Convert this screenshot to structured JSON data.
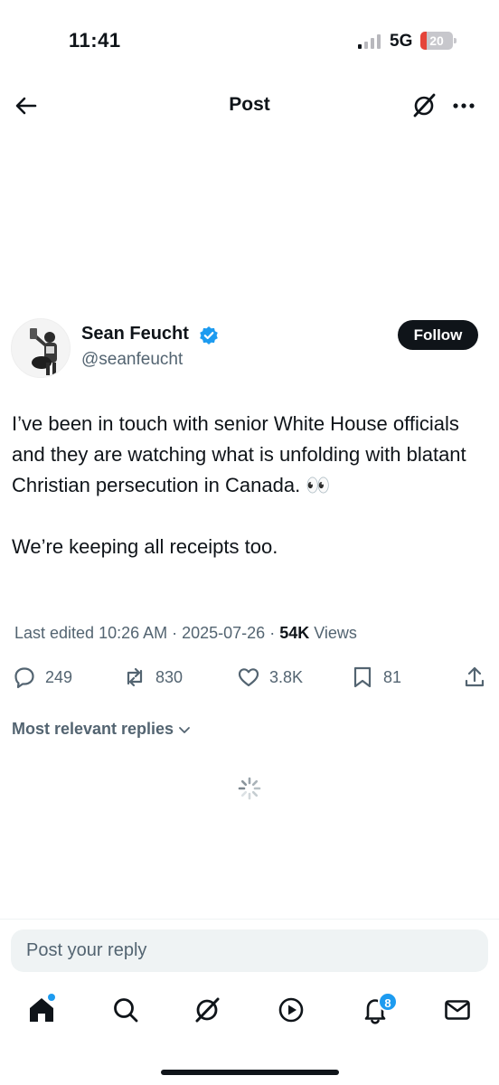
{
  "status_bar": {
    "time": "11:41",
    "network": "5G",
    "battery": "20",
    "battery_level_percent": 20,
    "battery_color": "#e5443a"
  },
  "header": {
    "title": "Post",
    "back_icon": "arrow-left-icon",
    "grok_icon": "grok-icon",
    "more_icon": "more-horizontal-icon"
  },
  "author": {
    "display_name": "Sean Feucht",
    "handle": "@seanfeucht",
    "verified": true,
    "follow_label": "Follow"
  },
  "tweet": {
    "paragraphs": [
      "I’ve been in touch with senior White House officials and they are watching what is unfolding with blatant Christian persecution in Canada. 👀",
      "We’re keeping all receipts too."
    ]
  },
  "meta": {
    "edited": "Last edited 10:26 AM · 2025-07-26 · ",
    "views_count": "54K",
    "views_label": " Views"
  },
  "actions": {
    "replies": "249",
    "reposts": "830",
    "likes": "3.8K",
    "bookmarks": "81"
  },
  "replies": {
    "sort_label": "Most relevant replies"
  },
  "reply_bar": {
    "placeholder": "Post your reply"
  },
  "tab_bar": {
    "notifications_badge": "8"
  },
  "colors": {
    "accent": "#1d9bf0",
    "text": "#0f1419",
    "muted": "#536471"
  }
}
